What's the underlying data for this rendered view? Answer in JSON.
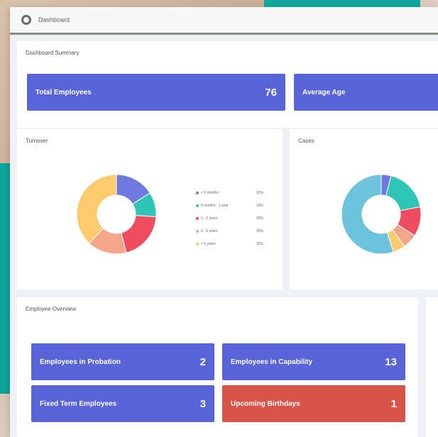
{
  "app": {
    "title": "Dashboard"
  },
  "summary": {
    "title": "Dashboard Summary",
    "tiles": [
      {
        "label": "Total Employees",
        "value": "76"
      },
      {
        "label": "Average Age",
        "value": ""
      }
    ]
  },
  "turnover": {
    "title": "Turnover",
    "legend": [
      {
        "label": "< 6 months",
        "pct": "10%",
        "color": "#6f79de"
      },
      {
        "label": "6 months - 1 year",
        "pct": "10%",
        "color": "#2ec4b6"
      },
      {
        "label": "1 - 2 years",
        "pct": "20%",
        "color": "#ef4c5f"
      },
      {
        "label": "2 - 5 years",
        "pct": "15%",
        "color": "#f4a58a"
      },
      {
        "label": "> 5 years",
        "pct": "35%",
        "color": "#fccb6d"
      }
    ]
  },
  "cases": {
    "title": "Cases"
  },
  "overview": {
    "title": "Employee Overview",
    "tiles": [
      {
        "label": "Employees in Probation",
        "value": "2",
        "color": "#5864d8"
      },
      {
        "label": "Employees in Capability",
        "value": "13",
        "color": "#5864d8"
      },
      {
        "label": "Fixed Term Employees",
        "value": "3",
        "color": "#5864d8"
      },
      {
        "label": "Upcoming Birthdays",
        "value": "1",
        "color": "#d95448"
      }
    ]
  },
  "chart_data": [
    {
      "type": "pie",
      "title": "Turnover",
      "categories": [
        "< 6 months",
        "6 months - 1 year",
        "1 - 2 years",
        "2 - 5 years",
        "> 5 years"
      ],
      "values": [
        16,
        10,
        20,
        16,
        38
      ],
      "colors": [
        "#6f79de",
        "#2ec4b6",
        "#ef4c5f",
        "#f4a58a",
        "#fccb6d"
      ]
    },
    {
      "type": "pie",
      "title": "Cases",
      "values": [
        4,
        18,
        12,
        6,
        5,
        55
      ],
      "colors": [
        "#6f79de",
        "#2ec4b6",
        "#ef4c5f",
        "#f4a58a",
        "#fccb6d",
        "#6ec3dc"
      ]
    }
  ]
}
